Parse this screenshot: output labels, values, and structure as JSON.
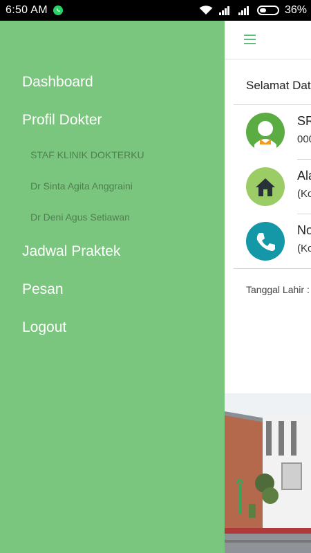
{
  "statusbar": {
    "time": "6:50",
    "ampm": "AM",
    "battery": "36%"
  },
  "drawer": {
    "items": [
      {
        "label": "Dashboard"
      },
      {
        "label": "Profil Dokter"
      },
      {
        "label": "Jadwal Praktek"
      },
      {
        "label": "Pesan"
      },
      {
        "label": "Logout"
      }
    ],
    "subitems": [
      {
        "label": "STAF KLINIK DOKTERKU"
      },
      {
        "label": "Dr Sinta Agita Anggraini"
      },
      {
        "label": "Dr Deni Agus Setiawan"
      }
    ]
  },
  "main": {
    "welcome": "Selamat Dat",
    "info": [
      {
        "icon": "user-icon",
        "title": "SR",
        "sub": "000"
      },
      {
        "icon": "home-icon",
        "title": "Ala",
        "sub": "(Ko"
      },
      {
        "icon": "phone-icon",
        "title": "No",
        "sub": "(Ko"
      }
    ],
    "dob_label": "Tanggal Lahir :"
  },
  "colors": {
    "drawer": "#7bc67e",
    "accent": "#5fbf78",
    "teal": "#1497a6"
  }
}
